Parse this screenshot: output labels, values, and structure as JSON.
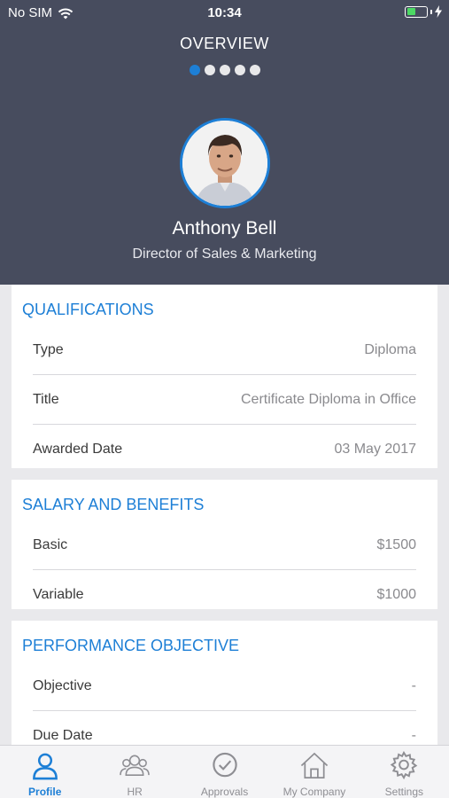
{
  "status_bar": {
    "carrier": "No SIM",
    "time": "10:34"
  },
  "header": {
    "title": "OVERVIEW",
    "page_count": 5,
    "active_page": 1
  },
  "profile": {
    "name": "Anthony Bell",
    "role": "Director of Sales & Marketing"
  },
  "sections": [
    {
      "title": "QUALIFICATIONS",
      "rows": [
        {
          "label": "Type",
          "value": "Diploma"
        },
        {
          "label": "Title",
          "value": "Certificate Diploma in Office"
        },
        {
          "label": "Awarded Date",
          "value": "03 May 2017"
        }
      ]
    },
    {
      "title": "SALARY AND BENEFITS",
      "rows": [
        {
          "label": "Basic",
          "value": "$1500"
        },
        {
          "label": "Variable",
          "value": "$1000"
        }
      ]
    },
    {
      "title": "PERFORMANCE OBJECTIVE",
      "rows": [
        {
          "label": "Objective",
          "value": "-"
        },
        {
          "label": "Due Date",
          "value": "-"
        }
      ]
    }
  ],
  "tabs": [
    {
      "label": "Profile",
      "icon": "person-icon",
      "active": true
    },
    {
      "label": "HR",
      "icon": "group-icon",
      "active": false
    },
    {
      "label": "Approvals",
      "icon": "check-circle-icon",
      "active": false
    },
    {
      "label": "My Company",
      "icon": "home-icon",
      "active": false
    },
    {
      "label": "Settings",
      "icon": "gear-icon",
      "active": false
    }
  ],
  "colors": {
    "header_bg": "#474c5e",
    "accent": "#1d7fd6",
    "battery": "#4cd964"
  }
}
